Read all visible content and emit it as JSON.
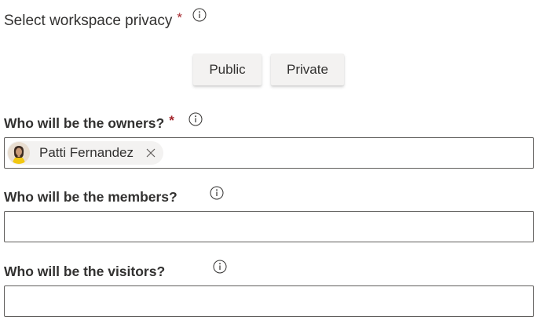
{
  "privacy": {
    "label": "Select workspace privacy",
    "required_marker": "*",
    "info_icon": "info-icon",
    "options": [
      "Public",
      "Private"
    ]
  },
  "owners": {
    "label": "Who will be the owners?",
    "required_marker": "*",
    "info_icon": "info-icon",
    "selected": [
      {
        "name": "Patti Fernandez",
        "avatar_icon": "person-avatar",
        "remove_icon": "close-icon"
      }
    ]
  },
  "members": {
    "label": "Who will be the members?",
    "info_icon": "info-icon",
    "value": ""
  },
  "visitors": {
    "label": "Who will be the visitors?",
    "info_icon": "info-icon",
    "value": ""
  },
  "colors": {
    "required": "#a4262c",
    "button_bg": "#f3f2f1",
    "border": "#605e5c",
    "text": "#323130"
  }
}
